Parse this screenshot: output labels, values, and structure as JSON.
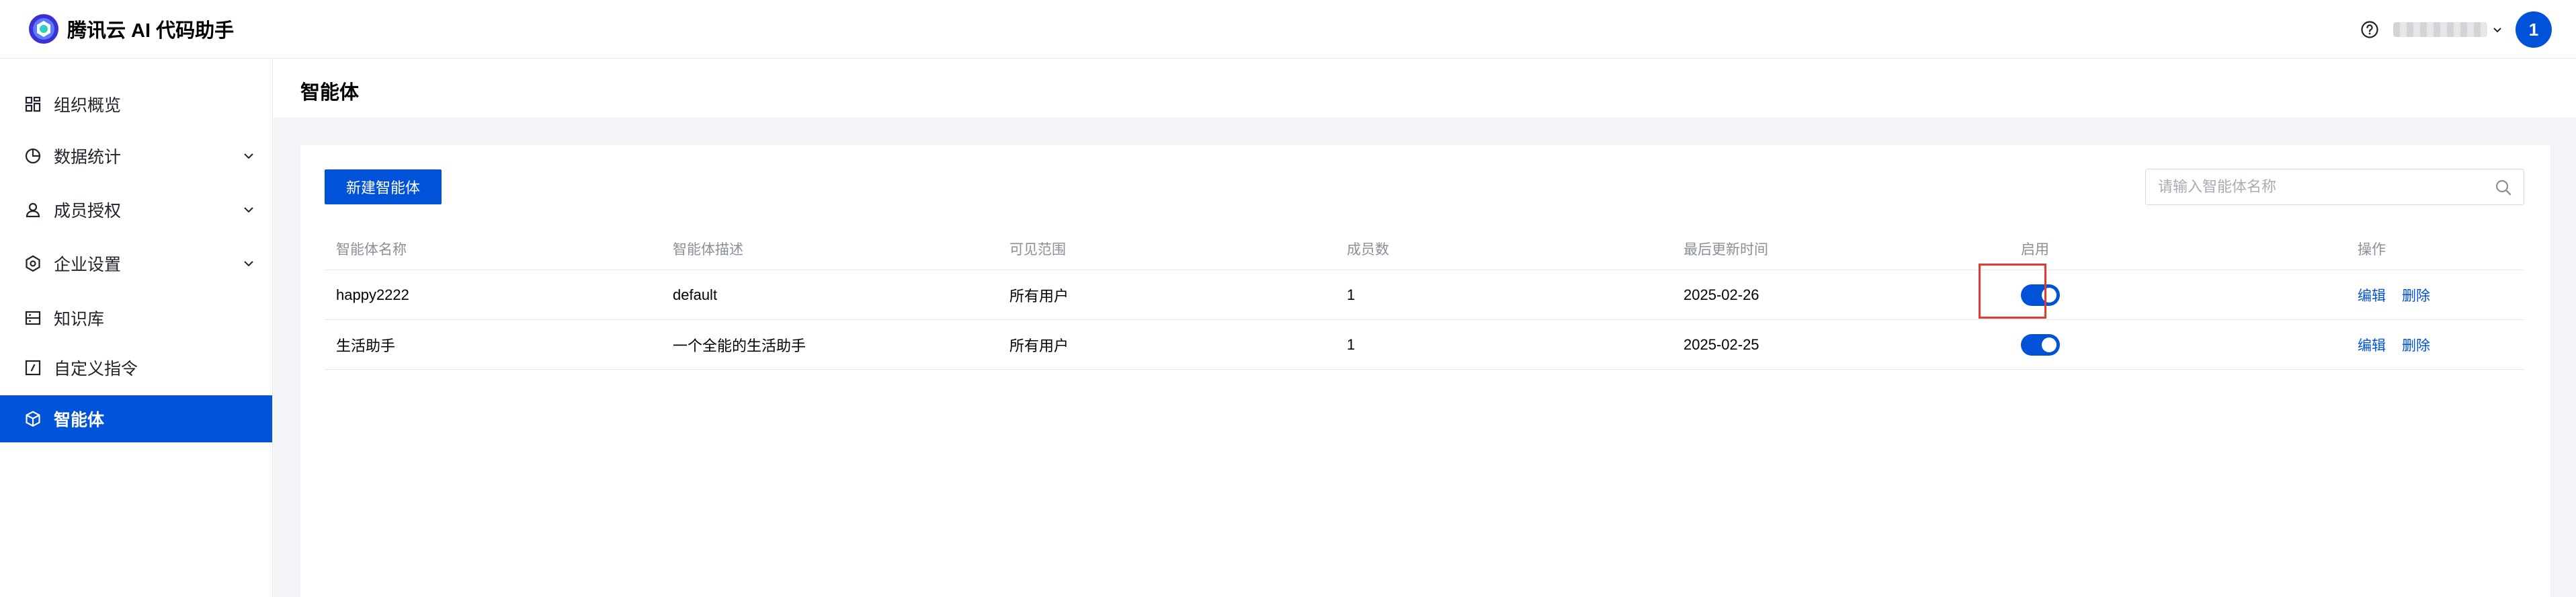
{
  "header": {
    "app_name": "腾讯云 AI 代码助手",
    "user_name": "username",
    "avatar_text": "1"
  },
  "sidebar": {
    "items": [
      {
        "label": "组织概览",
        "icon": "dashboard-grid-icon",
        "expandable": false
      },
      {
        "label": "数据统计",
        "icon": "pie-chart-icon",
        "expandable": true
      },
      {
        "label": "成员授权",
        "icon": "user-icon",
        "expandable": true
      },
      {
        "label": "企业设置",
        "icon": "gear-icon",
        "expandable": true
      },
      {
        "label": "知识库",
        "icon": "database-icon",
        "expandable": false
      },
      {
        "label": "自定义指令",
        "icon": "command-icon",
        "expandable": false
      },
      {
        "label": "智能体",
        "icon": "cube-icon",
        "expandable": false,
        "active": true
      }
    ]
  },
  "page": {
    "title": "智能体",
    "new_button": "新建智能体",
    "search_placeholder": "请输入智能体名称"
  },
  "table": {
    "columns": [
      "智能体名称",
      "智能体描述",
      "可见范围",
      "成员数",
      "最后更新时间",
      "启用",
      "操作"
    ],
    "rows": [
      {
        "name": "happy2222",
        "desc": "default",
        "scope": "所有用户",
        "members": "1",
        "updated": "2025-02-26",
        "enabled": true,
        "edit": "编辑",
        "delete": "删除"
      },
      {
        "name": "生活助手",
        "desc": "一个全能的生活助手",
        "scope": "所有用户",
        "members": "1",
        "updated": "2025-02-25",
        "enabled": true,
        "edit": "编辑",
        "delete": "删除"
      }
    ]
  },
  "colors": {
    "primary": "#0052d9",
    "highlight": "#e53935",
    "page_bg": "#f3f4f7"
  }
}
